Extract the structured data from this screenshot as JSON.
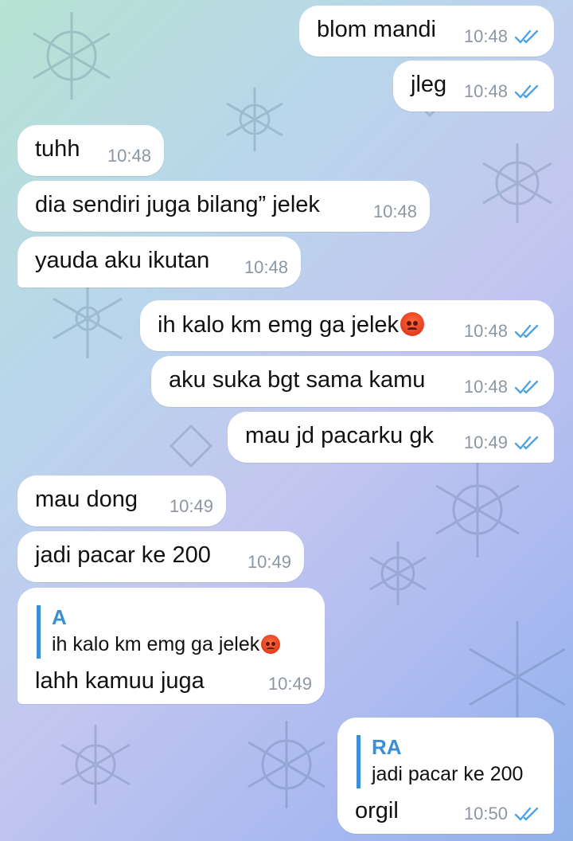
{
  "colors": {
    "bubble": "#ffffff",
    "tick": "#4fa3e0",
    "reply_accent": "#3a8fd6",
    "time": "#8c97a3"
  },
  "messages": [
    {
      "dir": "out",
      "text": "blom mandi",
      "time": "10:48",
      "read": true
    },
    {
      "dir": "out",
      "text": "jleg",
      "time": "10:48",
      "read": true
    },
    {
      "dir": "in",
      "text": "tuhh",
      "time": "10:48"
    },
    {
      "dir": "in",
      "text": "dia sendiri juga bilang” jelek",
      "time": "10:48"
    },
    {
      "dir": "in",
      "text": "yauda aku ikutan",
      "time": "10:48"
    },
    {
      "dir": "out",
      "text": "ih kalo km emg ga jelek",
      "emoji": "angry-face-emoji",
      "time": "10:48",
      "read": true
    },
    {
      "dir": "out",
      "text": "aku suka bgt sama kamu",
      "time": "10:48",
      "read": true
    },
    {
      "dir": "out",
      "text": "mau jd pacarku gk",
      "time": "10:49",
      "read": true
    },
    {
      "dir": "in",
      "text": "mau dong",
      "time": "10:49"
    },
    {
      "dir": "in",
      "text": "jadi pacar ke 200",
      "time": "10:49"
    },
    {
      "dir": "in",
      "reply_name": "A",
      "reply_text": "ih kalo km emg ga jelek",
      "reply_emoji": "angry-face-emoji",
      "text": "lahh kamuu juga",
      "time": "10:49"
    },
    {
      "dir": "out",
      "reply_name": "RA",
      "reply_text": "jadi pacar ke 200",
      "text": "orgil",
      "time": "10:50",
      "read": true
    }
  ]
}
